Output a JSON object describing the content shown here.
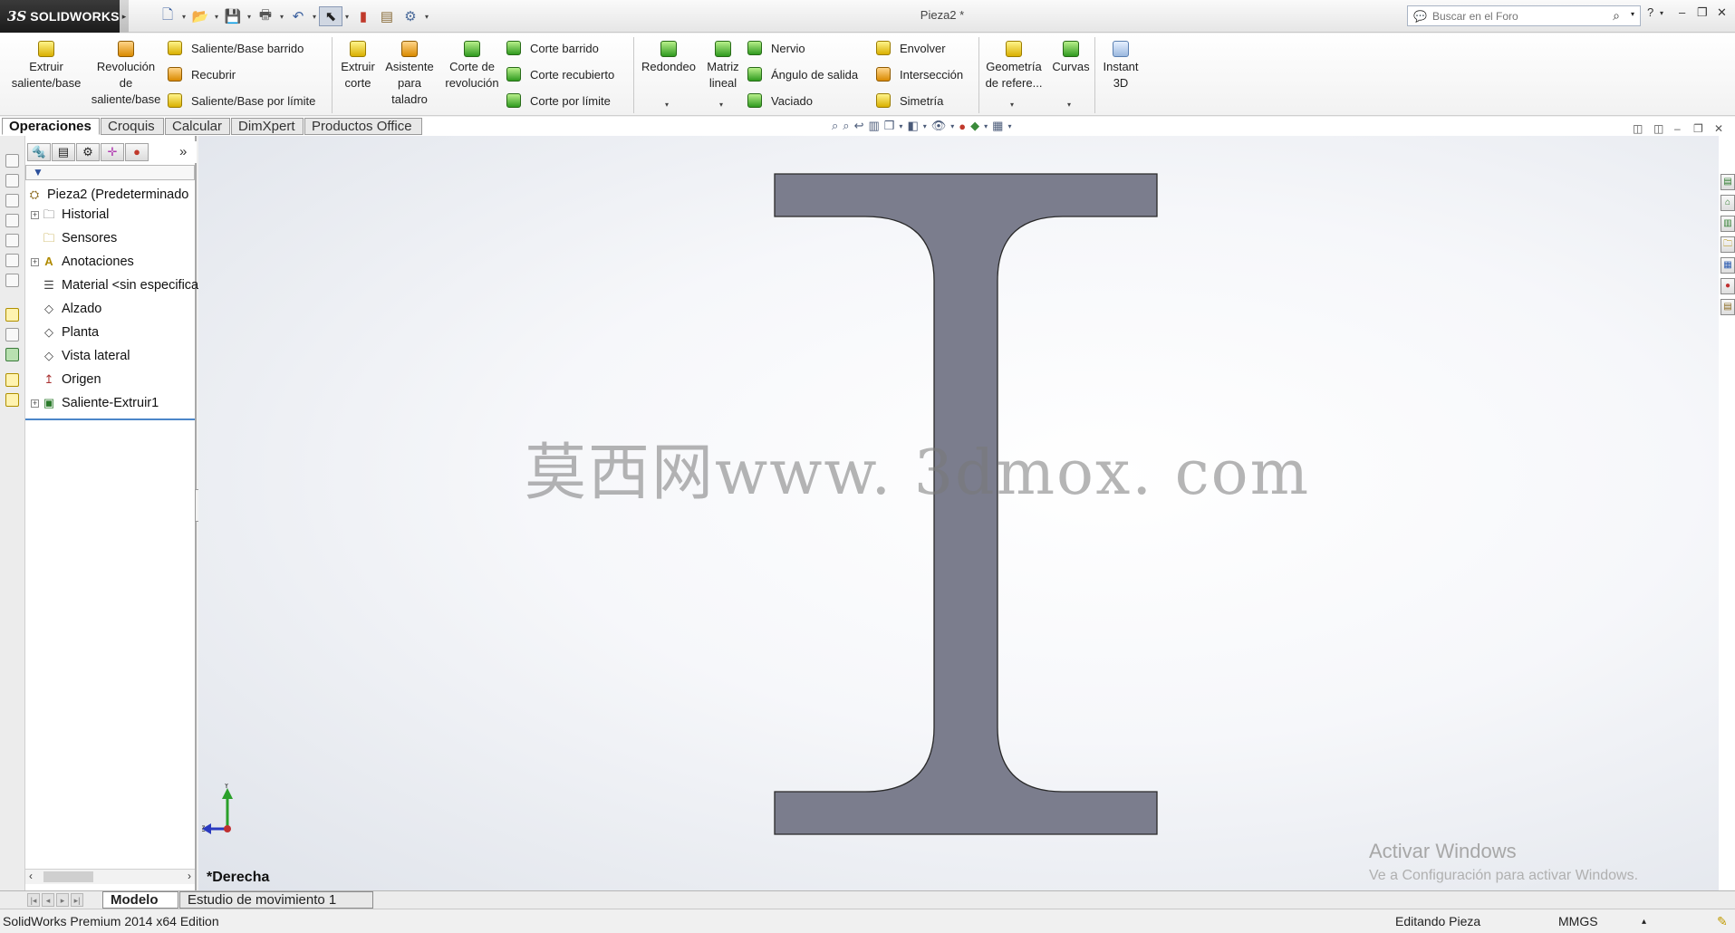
{
  "app": {
    "logo_text": "SOLIDWORKS",
    "logo_ds": "3S",
    "window_title": "Pieza2 *"
  },
  "search": {
    "placeholder": "Buscar en el Foro"
  },
  "ribbon": {
    "extrude_boss": [
      "Extruir",
      "saliente/base"
    ],
    "revolve_boss": [
      "Revolución",
      "de",
      "saliente/base"
    ],
    "swept_boss": "Saliente/Base barrido",
    "loft": "Recubrir",
    "boundary_boss": "Saliente/Base por límite",
    "extrude_cut": [
      "Extruir",
      "corte"
    ],
    "hole_wizard": [
      "Asistente",
      "para",
      "taladro"
    ],
    "revolve_cut": [
      "Corte de",
      "revolución"
    ],
    "swept_cut": "Corte barrido",
    "lofted_cut": "Corte recubierto",
    "boundary_cut": "Corte por límite",
    "fillet": "Redondeo",
    "linear_pattern": [
      "Matriz",
      "lineal"
    ],
    "rib": "Nervio",
    "draft": "Ángulo de salida",
    "shell": "Vaciado",
    "wrap": "Envolver",
    "intersect": "Intersección",
    "mirror": "Simetría",
    "ref_geometry": [
      "Geometría",
      "de refere..."
    ],
    "curves": "Curvas",
    "instant3d": [
      "Instant",
      "3D"
    ]
  },
  "tabs": [
    "Operaciones",
    "Croquis",
    "Calcular",
    "DimXpert",
    "Productos Office"
  ],
  "feature_tree": {
    "root": "Pieza2  (Predeterminado",
    "items": [
      "Historial",
      "Sensores",
      "Anotaciones",
      "Material <sin especificar>",
      "Alzado",
      "Planta",
      "Vista lateral",
      "Origen",
      "Saliente-Extruir1"
    ]
  },
  "viewport": {
    "view_name": "*Derecha",
    "watermark": "莫西网www. 3dmox. com",
    "activate_title": "Activar Windows",
    "activate_sub": "Ve a Configuración para activar Windows.",
    "triad_y": "Y",
    "triad_z": "Z",
    "part_color": "#7b7d8d"
  },
  "bottom_tabs": [
    "Modelo",
    "Estudio de movimiento 1"
  ],
  "status": {
    "edition": "SolidWorks Premium 2014 x64 Edition",
    "mode": "Editando Pieza",
    "units": "MMGS",
    "units_arrow": "▴"
  }
}
